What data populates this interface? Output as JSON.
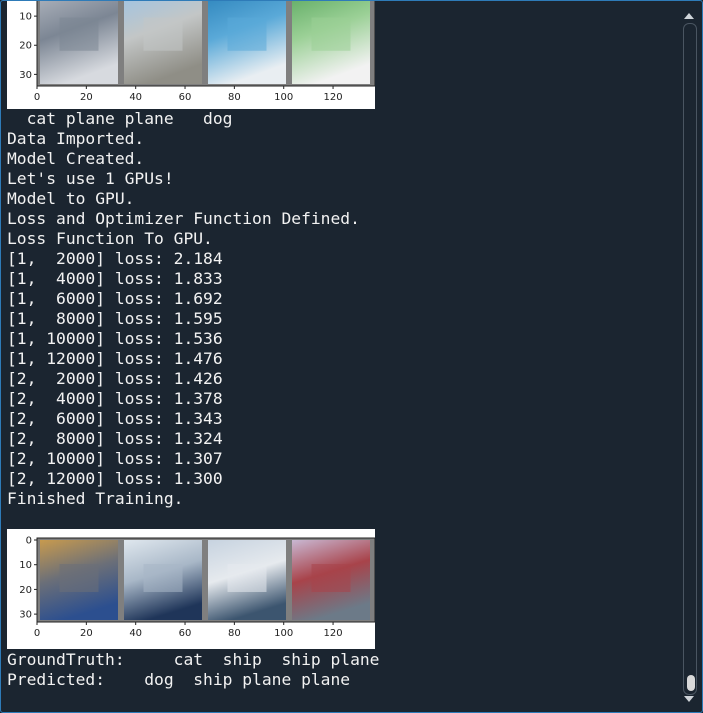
{
  "figure1": {
    "x_ticks": [
      "0",
      "20",
      "40",
      "60",
      "80",
      "100",
      "120"
    ],
    "y_ticks": [
      "10",
      "20",
      "30"
    ],
    "tiles": [
      {
        "name": "cat-thumbnail",
        "colors": [
          "#b3b8c1",
          "#7c8694",
          "#d7dadf"
        ]
      },
      {
        "name": "plane-thumbnail",
        "colors": [
          "#9cc4e6",
          "#c3c6c6",
          "#8f8e86"
        ]
      },
      {
        "name": "plane-thumbnail",
        "colors": [
          "#2a82ba",
          "#5aa9d8",
          "#e9eef2"
        ]
      },
      {
        "name": "dog-thumbnail",
        "colors": [
          "#5aa85f",
          "#9bd096",
          "#f2f2f2"
        ]
      }
    ]
  },
  "figure1_labels": "  cat plane plane   dog",
  "log": {
    "lines": [
      "Data Imported.",
      "Model Created.",
      "Let's use 1 GPUs!",
      "Model to GPU.",
      "Loss and Optimizer Function Defined.",
      "Loss Function To GPU.",
      "[1,  2000] loss: 2.184",
      "[1,  4000] loss: 1.833",
      "[1,  6000] loss: 1.692",
      "[1,  8000] loss: 1.595",
      "[1, 10000] loss: 1.536",
      "[1, 12000] loss: 1.476",
      "[2,  2000] loss: 1.426",
      "[2,  4000] loss: 1.378",
      "[2,  6000] loss: 1.343",
      "[2,  8000] loss: 1.324",
      "[2, 10000] loss: 1.307",
      "[2, 12000] loss: 1.300",
      "Finished Training."
    ]
  },
  "figure2": {
    "x_ticks": [
      "0",
      "20",
      "40",
      "60",
      "80",
      "100",
      "120"
    ],
    "y_ticks": [
      "0",
      "10",
      "20",
      "30"
    ],
    "tiles": [
      {
        "name": "cat-thumbnail",
        "colors": [
          "#c79a4e",
          "#6b6f78",
          "#2c4f8f"
        ]
      },
      {
        "name": "ship-thumbnail",
        "colors": [
          "#dfe7ee",
          "#a8b7c7",
          "#1f3559"
        ]
      },
      {
        "name": "ship-thumbnail",
        "colors": [
          "#c7d3e0",
          "#e6eaee",
          "#3c556f"
        ]
      },
      {
        "name": "plane-thumbnail",
        "colors": [
          "#c9b8d3",
          "#a8434a",
          "#6c7a88"
        ]
      }
    ]
  },
  "results": {
    "groundtruth": "GroundTruth:     cat  ship  ship plane",
    "predicted": "Predicted:    dog  ship plane plane"
  },
  "colors": {
    "background": "#1b2530",
    "text": "#f2f2f2",
    "border": "#2e7bb8"
  }
}
